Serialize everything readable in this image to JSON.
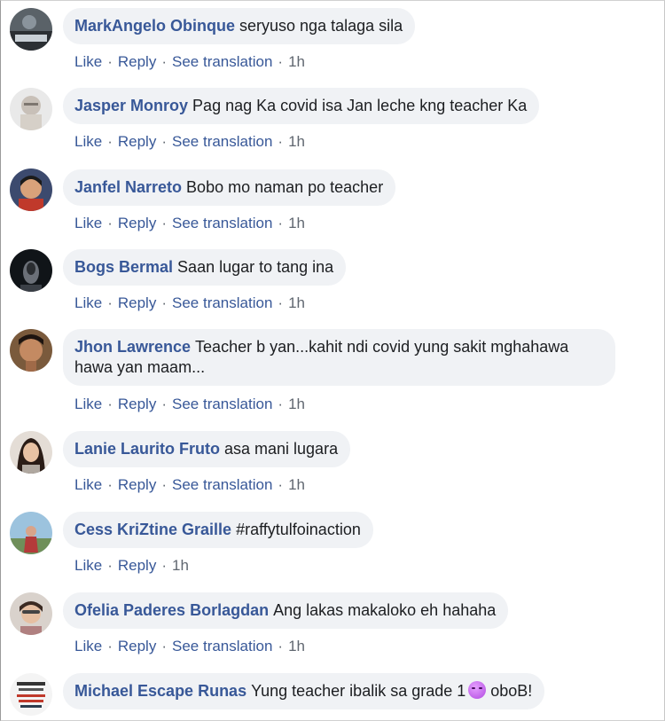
{
  "actions": {
    "like": "Like",
    "reply": "Reply",
    "see_translation": "See translation",
    "separator": "·"
  },
  "comments": [
    {
      "author": "MarkAngelo Obinque",
      "text": "seryuso nga talaga sila",
      "time": "1h"
    },
    {
      "author": "Jasper Monroy",
      "text": "Pag nag Ka covid isa Jan leche kng teacher Ka",
      "time": "1h"
    },
    {
      "author": "Janfel Narreto",
      "text": "Bobo mo naman po teacher",
      "time": "1h"
    },
    {
      "author": "Bogs Bermal",
      "text": "Saan lugar to tang ina",
      "time": "1h"
    },
    {
      "author": "Jhon Lawrence",
      "text": "Teacher b yan...kahit ndi covid yung sakit mghahawa hawa yan maam...",
      "time": "1h"
    },
    {
      "author": "Lanie Laurito Fruto",
      "text": "asa mani lugara",
      "time": "1h"
    },
    {
      "author": "Cess KriZtine Graille",
      "text": "#raffytulfoinaction",
      "time": "1h"
    },
    {
      "author": "Ofelia Paderes Borlagdan",
      "text": "Ang lakas makaloko eh hahaha",
      "time": "1h"
    },
    {
      "author": "Michael Escape Runas",
      "text": "Yung teacher ibalik sa grade 1",
      "text_after_emoji": "oboB!",
      "emoji": "purple-face-emoji"
    }
  ],
  "colors": {
    "author": "#385898",
    "bubble": "#f0f2f5",
    "meta": "#606770",
    "text": "#1c1e21"
  }
}
